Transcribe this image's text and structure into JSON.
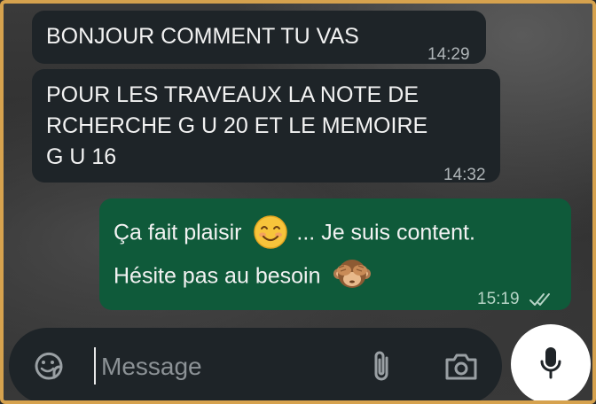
{
  "messages": [
    {
      "direction": "incoming",
      "text": "BONJOUR COMMENT TU VAS",
      "time": "14:29"
    },
    {
      "direction": "incoming",
      "lines": [
        "POUR LES TRAVEAUX LA NOTE DE",
        "RCHERCHE G U 20 ET LE MEMOIRE",
        "G U 16"
      ],
      "time": "14:32"
    },
    {
      "direction": "outgoing",
      "line1_before": "Ça fait plaisir",
      "line1_after": "... Je suis content.",
      "line2": "Hésite pas au besoin",
      "time": "15:19",
      "status": "read",
      "emoji1": "smiling-face-icon",
      "emoji2": "see-no-evil-monkey-icon"
    }
  ],
  "composer": {
    "placeholder": "Message",
    "icons": [
      "sticker-icon",
      "attach-icon",
      "camera-icon",
      "microphone-icon"
    ]
  },
  "colors": {
    "incoming_bubble": "#1e2428",
    "outgoing_bubble": "#0f5a3a",
    "frame_border": "#d6a24e"
  }
}
